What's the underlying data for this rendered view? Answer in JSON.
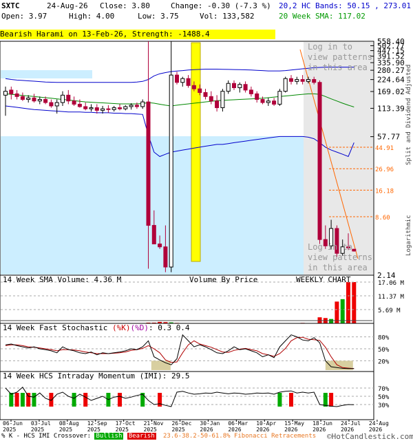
{
  "header": {
    "symbol": "SXTC",
    "date": "24-Aug-26",
    "close": "Close: 3.80",
    "change": "Change: -0.30 (-7.3 %)",
    "open": "Open: 3.97",
    "high": "High: 4.00",
    "low": "Low: 3.75",
    "volume": "Vol: 133,582",
    "bands": "20,2 HC Bands: 50.15 , 273.01",
    "sma": "20 Week SMA: 117.02"
  },
  "pattern_label": "Bearish Harami on 13-Feb-26, Strength: -1488.4",
  "watermark": [
    "Log in to",
    "view patterns",
    "in this area"
  ],
  "side_label_top": "Split and Dividend Adjusted",
  "side_label_bottom": "Logarithmic",
  "price_ticks": [
    "558.40",
    "502.77",
    "447.15",
    "391.52",
    "335.90",
    "280.27",
    "224.64",
    "169.02",
    "113.39",
    "57.77",
    "2.14"
  ],
  "fib_ticks": [
    "44.91",
    "26.96",
    "16.18",
    "8.60"
  ],
  "volume_panel": {
    "label": "14 Week SMA Volume: 4.36 M",
    "vbp_label": "Volume By Price",
    "chart_label": "WEEKLY CHART",
    "ticks": [
      "17.06 M",
      "11.37 M",
      "5.69 M"
    ]
  },
  "stoch_panel": {
    "label_prefix": "14 Week Fast Stochastic ",
    "label_k": "(%K)",
    "label_d": "(%D)",
    "label_values": ": 0.3  0.4",
    "ticks": [
      "80%",
      "50%",
      "20%"
    ]
  },
  "imi_panel": {
    "label": "14 Week HCS Intraday Momentum (IMI): 29.5",
    "ticks": [
      "70%",
      "50%",
      "30%"
    ]
  },
  "x_labels": [
    [
      "06-Jun",
      "2025"
    ],
    [
      "03-Jul",
      "2025"
    ],
    [
      "08-Aug",
      "2025"
    ],
    [
      "12-Sep",
      "2025"
    ],
    [
      "17-Oct",
      "2025"
    ],
    [
      "21-Nov",
      "2025"
    ],
    [
      "26-Dec",
      "2025"
    ],
    [
      "30-Jan",
      "2026"
    ],
    [
      "06-Mar",
      "2026"
    ],
    [
      "10-Apr",
      "2026"
    ],
    [
      "15-May",
      "2026"
    ],
    [
      "18-Jun",
      "2026"
    ],
    [
      "24-Jul",
      "2026"
    ],
    [
      "24-Aug",
      "2026"
    ]
  ],
  "footer": {
    "prefix": "% K - HCS IMI Crossover:",
    "bullish": "Bullish",
    "bearish": "Bearish",
    "fib": "23.6-38.2-50-61.8% Fibonacci Retracements",
    "copyright": "©HotCandlestick.com"
  },
  "colors": {
    "up": "#00aa00",
    "down": "#b0003a",
    "band": "#0000cc",
    "sma": "#008800",
    "fib": "#ff6600",
    "vbp": "#cceeff",
    "highlight": "#ffff00"
  },
  "chart_data": {
    "type": "candlestick",
    "scale": "logarithmic",
    "ylim": [
      2.14,
      558.4
    ],
    "pattern": {
      "name": "Bearish Harami",
      "date": "13-Feb-26",
      "strength": -1488.4
    },
    "candles": [
      {
        "o": 155,
        "h": 190,
        "l": 95,
        "c": 170
      },
      {
        "o": 175,
        "h": 190,
        "l": 140,
        "c": 160
      },
      {
        "o": 160,
        "h": 175,
        "l": 140,
        "c": 150
      },
      {
        "o": 150,
        "h": 165,
        "l": 135,
        "c": 140
      },
      {
        "o": 140,
        "h": 155,
        "l": 130,
        "c": 145
      },
      {
        "o": 145,
        "h": 160,
        "l": 130,
        "c": 135
      },
      {
        "o": 135,
        "h": 150,
        "l": 125,
        "c": 140
      },
      {
        "o": 140,
        "h": 150,
        "l": 125,
        "c": 130
      },
      {
        "o": 130,
        "h": 140,
        "l": 115,
        "c": 120
      },
      {
        "o": 120,
        "h": 140,
        "l": 100,
        "c": 130
      },
      {
        "o": 130,
        "h": 170,
        "l": 120,
        "c": 155
      },
      {
        "o": 155,
        "h": 175,
        "l": 125,
        "c": 135
      },
      {
        "o": 135,
        "h": 150,
        "l": 120,
        "c": 125
      },
      {
        "o": 125,
        "h": 140,
        "l": 115,
        "c": 118
      },
      {
        "o": 118,
        "h": 130,
        "l": 108,
        "c": 112
      },
      {
        "o": 112,
        "h": 125,
        "l": 105,
        "c": 115
      },
      {
        "o": 115,
        "h": 125,
        "l": 100,
        "c": 108
      },
      {
        "o": 108,
        "h": 120,
        "l": 100,
        "c": 112
      },
      {
        "o": 112,
        "h": 122,
        "l": 102,
        "c": 110
      },
      {
        "o": 110,
        "h": 120,
        "l": 105,
        "c": 115
      },
      {
        "o": 115,
        "h": 125,
        "l": 108,
        "c": 112
      },
      {
        "o": 112,
        "h": 122,
        "l": 108,
        "c": 118
      },
      {
        "o": 118,
        "h": 128,
        "l": 110,
        "c": 122
      },
      {
        "o": 122,
        "h": 130,
        "l": 112,
        "c": 118
      },
      {
        "o": 118,
        "h": 140,
        "l": 112,
        "c": 132
      },
      {
        "o": 132,
        "h": 558,
        "l": 2.5,
        "c": 7
      },
      {
        "o": 7,
        "h": 10,
        "l": 5,
        "c": 4.5
      },
      {
        "o": 4.5,
        "h": 5.5,
        "l": 4,
        "c": 4.2
      },
      {
        "o": 4.2,
        "h": 7,
        "l": 2.3,
        "c": 2.6
      },
      {
        "o": 2.6,
        "h": 558,
        "l": 2.3,
        "c": 250
      },
      {
        "o": 250,
        "h": 270,
        "l": 200,
        "c": 210
      },
      {
        "o": 210,
        "h": 240,
        "l": 190,
        "c": 230
      },
      {
        "o": 230,
        "h": 250,
        "l": 185,
        "c": 195
      },
      {
        "o": 195,
        "h": 215,
        "l": 170,
        "c": 180
      },
      {
        "o": 180,
        "h": 200,
        "l": 155,
        "c": 165
      },
      {
        "o": 165,
        "h": 180,
        "l": 140,
        "c": 150
      },
      {
        "o": 150,
        "h": 170,
        "l": 125,
        "c": 135
      },
      {
        "o": 135,
        "h": 155,
        "l": 105,
        "c": 115
      },
      {
        "o": 115,
        "h": 180,
        "l": 105,
        "c": 170
      },
      {
        "o": 170,
        "h": 220,
        "l": 160,
        "c": 205
      },
      {
        "o": 205,
        "h": 220,
        "l": 175,
        "c": 185
      },
      {
        "o": 185,
        "h": 210,
        "l": 165,
        "c": 200
      },
      {
        "o": 200,
        "h": 215,
        "l": 165,
        "c": 175
      },
      {
        "o": 175,
        "h": 190,
        "l": 150,
        "c": 160
      },
      {
        "o": 160,
        "h": 170,
        "l": 130,
        "c": 140
      },
      {
        "o": 140,
        "h": 150,
        "l": 125,
        "c": 130
      },
      {
        "o": 130,
        "h": 145,
        "l": 120,
        "c": 135
      },
      {
        "o": 135,
        "h": 145,
        "l": 120,
        "c": 125
      },
      {
        "o": 125,
        "h": 180,
        "l": 120,
        "c": 170
      },
      {
        "o": 170,
        "h": 240,
        "l": 165,
        "c": 230
      },
      {
        "o": 230,
        "h": 250,
        "l": 200,
        "c": 215
      },
      {
        "o": 215,
        "h": 240,
        "l": 200,
        "c": 225
      },
      {
        "o": 225,
        "h": 250,
        "l": 200,
        "c": 215
      },
      {
        "o": 215,
        "h": 240,
        "l": 205,
        "c": 225
      },
      {
        "o": 225,
        "h": 240,
        "l": 200,
        "c": 210
      },
      {
        "o": 210,
        "h": 220,
        "l": 4.5,
        "c": 5
      },
      {
        "o": 5,
        "h": 7,
        "l": 4,
        "c": 4.3
      },
      {
        "o": 4.3,
        "h": 8,
        "l": 4,
        "c": 6.5
      },
      {
        "o": 6.5,
        "h": 7,
        "l": 3.3,
        "c": 3.6
      },
      {
        "o": 3.6,
        "h": 5,
        "l": 3.4,
        "c": 4.2
      },
      {
        "o": 4.2,
        "h": 5.8,
        "l": 3.9,
        "c": 4.1
      },
      {
        "o": 3.97,
        "h": 4.0,
        "l": 3.75,
        "c": 3.8
      }
    ],
    "bollinger_upper": [
      230,
      225,
      222,
      220,
      218,
      216,
      214,
      212,
      211,
      210,
      210,
      210,
      210,
      210,
      210,
      210,
      210,
      210,
      210,
      210,
      210,
      210,
      210,
      212,
      215,
      225,
      245,
      258,
      265,
      272,
      275,
      278,
      282,
      284,
      286,
      288,
      288,
      288,
      287,
      286,
      285,
      284,
      283,
      282,
      280,
      278,
      276,
      276,
      276,
      278,
      282,
      286,
      290,
      294,
      298,
      300,
      302,
      302,
      302,
      302,
      302,
      302
    ],
    "sma20": [
      160,
      158,
      156,
      154,
      152,
      150,
      148,
      146,
      144,
      142,
      140,
      138,
      136,
      134,
      132,
      131,
      130,
      129,
      128,
      127,
      126,
      126,
      126,
      126,
      127,
      130,
      128,
      125,
      122,
      120,
      122,
      124,
      126,
      128,
      130,
      132,
      134,
      136,
      137,
      138,
      139,
      140,
      141,
      142,
      143,
      144,
      146,
      148,
      150,
      152,
      154,
      156,
      158,
      160,
      160,
      158,
      150,
      142,
      135,
      128,
      122,
      117.02
    ],
    "bollinger_lower": [
      120,
      118,
      116,
      114,
      112,
      110,
      109,
      108,
      107,
      106,
      105,
      104,
      104,
      104,
      103,
      103,
      102,
      102,
      102,
      101,
      101,
      100,
      100,
      99,
      98,
      60,
      40,
      36,
      38,
      40,
      41,
      42,
      43,
      44,
      45,
      46,
      47,
      48,
      48,
      49,
      50,
      51,
      52,
      53,
      54,
      55,
      56,
      57,
      58,
      58,
      58,
      58,
      58,
      57,
      55,
      50,
      45,
      42,
      40,
      38,
      36,
      50.15
    ],
    "fib_levels": [
      44.91,
      26.96,
      16.18,
      8.6
    ],
    "volume": [
      0,
      0,
      0,
      0,
      0,
      0,
      0,
      0,
      0,
      0,
      0,
      0,
      0,
      0,
      0,
      0,
      0,
      0,
      0,
      0,
      0,
      0,
      0,
      0,
      0,
      0.3,
      0.3,
      0.6,
      0.5,
      0.4,
      0.2,
      0.1,
      0.1,
      0.1,
      0.1,
      0.1,
      0.1,
      0.1,
      0.1,
      0.1,
      0.1,
      0.1,
      0.1,
      0.1,
      0.1,
      0.1,
      0.1,
      0.1,
      0.1,
      0.1,
      0.1,
      0.1,
      0.2,
      0.1,
      0.1,
      2.5,
      2.2,
      1.8,
      9.0,
      10.0,
      17.06,
      17.06
    ],
    "stoch_k": [
      60,
      62,
      58,
      55,
      52,
      55,
      50,
      48,
      45,
      40,
      55,
      48,
      45,
      40,
      38,
      42,
      35,
      40,
      38,
      40,
      42,
      45,
      50,
      48,
      55,
      70,
      30,
      22,
      15,
      10,
      25,
      85,
      70,
      55,
      60,
      55,
      48,
      40,
      38,
      45,
      55,
      48,
      50,
      45,
      40,
      30,
      35,
      28,
      55,
      70,
      85,
      80,
      72,
      70,
      78,
      65,
      20,
      5,
      3,
      1,
      0.5,
      0.3
    ],
    "stoch_d": [
      58,
      60,
      60,
      58,
      55,
      54,
      52,
      50,
      48,
      45,
      48,
      48,
      47,
      45,
      42,
      40,
      38,
      38,
      38,
      39,
      40,
      42,
      46,
      48,
      51,
      58,
      50,
      40,
      22,
      16,
      17,
      40,
      60,
      70,
      62,
      58,
      54,
      48,
      42,
      41,
      46,
      49,
      51,
      48,
      45,
      38,
      35,
      31,
      38,
      51,
      70,
      78,
      79,
      74,
      73,
      71,
      54,
      30,
      10,
      3,
      1.6,
      0.4
    ],
    "imi": [
      70,
      55,
      60,
      72,
      50,
      48,
      58,
      45,
      40,
      55,
      60,
      50,
      45,
      55,
      48,
      40,
      45,
      50,
      42,
      48,
      50,
      45,
      48,
      52,
      55,
      40,
      30,
      32,
      28,
      25,
      60,
      62,
      58,
      55,
      56,
      58,
      57,
      60,
      58,
      56,
      58,
      57,
      55,
      56,
      58,
      57,
      58,
      55,
      60,
      62,
      63,
      58,
      60,
      58,
      60,
      30,
      28,
      26,
      25,
      28,
      30,
      29.5
    ],
    "crossovers_bullish": [
      1,
      3,
      5,
      12,
      18,
      24,
      48,
      56
    ],
    "crossovers_bearish": [
      2,
      4,
      8,
      14,
      20,
      27,
      50,
      57
    ]
  }
}
